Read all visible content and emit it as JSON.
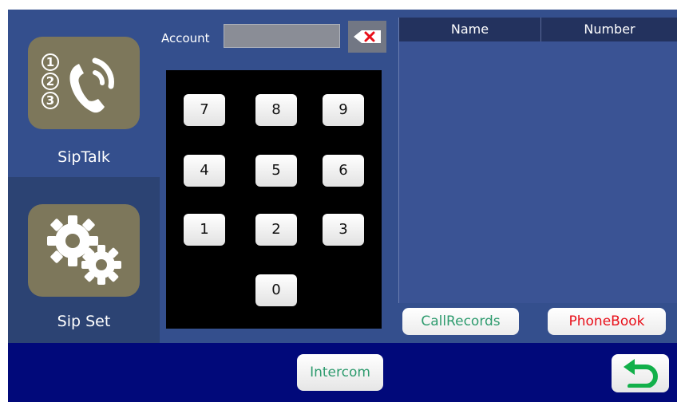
{
  "sidebar": {
    "items": [
      {
        "label": "SipTalk",
        "icon": "sip-talk-icon",
        "selected": false
      },
      {
        "label": "Sip Set",
        "icon": "settings-gears-icon",
        "selected": true
      }
    ]
  },
  "account": {
    "label": "Account",
    "value": "",
    "delete_icon": "backspace-icon"
  },
  "keypad": {
    "keys": [
      "7",
      "8",
      "9",
      "4",
      "5",
      "6",
      "1",
      "2",
      "3",
      "0"
    ]
  },
  "table": {
    "columns": [
      "Name",
      "Number"
    ],
    "rows": []
  },
  "tabs": [
    {
      "label": "CallRecords",
      "color": "#2e9b6e"
    },
    {
      "label": "PhoneBook",
      "color": "#e8101a"
    }
  ],
  "bottom": {
    "intercom_label": "Intercom",
    "back_icon": "return-arrow-icon"
  },
  "colors": {
    "background": "#344f8d",
    "bottom_bar": "#01097a",
    "tile": "#7d775b",
    "accent_green": "#2e9b6e",
    "accent_red": "#e8101a"
  }
}
